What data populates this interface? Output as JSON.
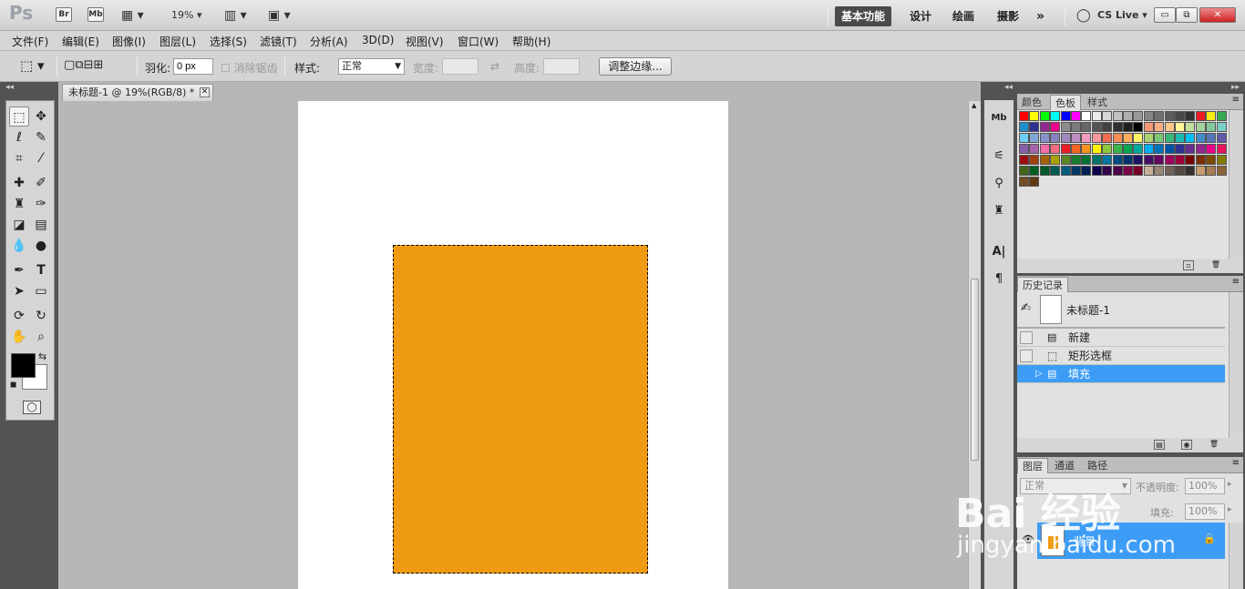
{
  "app": {
    "logo": "Ps",
    "bridge_btn": "Br",
    "minibridge_btn": "Mb",
    "zoom": "19%",
    "workspaces": [
      "基本功能",
      "设计",
      "绘画",
      "摄影"
    ],
    "more": "»",
    "cslive": "CS Live",
    "win_controls": [
      "▭",
      "⧉",
      "✕"
    ]
  },
  "menubar": [
    "文件(F)",
    "编辑(E)",
    "图像(I)",
    "图层(L)",
    "选择(S)",
    "滤镜(T)",
    "分析(A)",
    "3D(D)",
    "视图(V)",
    "窗口(W)",
    "帮助(H)"
  ],
  "options": {
    "feather_label": "羽化:",
    "feather_value": "0 px",
    "antialias_label": "消除锯齿",
    "style_label": "样式:",
    "style_value": "正常",
    "width_label": "宽度:",
    "height_label": "高度:",
    "refine_edge": "调整边缘..."
  },
  "document": {
    "tab_title": "未标题-1 @ 19%(RGB/8) *",
    "close": "✕",
    "fill_color": "#ef9a13"
  },
  "panels": {
    "color_tabs": [
      "颜色",
      "色板",
      "样式"
    ],
    "history_tab": "历史记录",
    "history_snapshot": "未标题-1",
    "history_items": [
      "新建",
      "矩形选框",
      "填充"
    ],
    "layers_tabs": [
      "图层",
      "通道",
      "路径"
    ],
    "blend_mode": "正常",
    "opacity_label": "不透明度:",
    "opacity_value": "100%",
    "fill_label": "填充:",
    "fill_value": "100%",
    "layer_name": "背景"
  },
  "watermark": {
    "line1": "Bai 经验",
    "line2": "jingyan.baidu.com"
  },
  "swatch_colors": [
    "#ff0000",
    "#ffff00",
    "#00ff00",
    "#00ffff",
    "#0000ff",
    "#ff00ff",
    "#ffffff",
    "#ebebeb",
    "#d6d6d6",
    "#c2c2c2",
    "#adadad",
    "#999999",
    "#858585",
    "#707070",
    "#5c5c5c",
    "#474747",
    "#333333",
    "#ed1c24",
    "#f7ec13",
    "#36a852",
    "#1f8fce",
    "#2f3192",
    "#92278f",
    "#ec008c",
    "#8c8c8c",
    "#7a7a7a",
    "#666666",
    "#545454",
    "#424242",
    "#303030",
    "#1f1f1f",
    "#000000",
    "#f7977a",
    "#f9ad81",
    "#fdc68a",
    "#fff79a",
    "#c4df9b",
    "#a3d39c",
    "#82ca9d",
    "#7bcdc8",
    "#6ecff6",
    "#7ea7d8",
    "#8493ca",
    "#8882be",
    "#a187be",
    "#bc8dbf",
    "#f49ac2",
    "#f6989d",
    "#f26c4f",
    "#f68e56",
    "#fbaf5c",
    "#fff467",
    "#acd372",
    "#7cc576",
    "#3bb878",
    "#1abbb4",
    "#00bff3",
    "#438ccb",
    "#5574b9",
    "#605ca8",
    "#855fa8",
    "#a763a8",
    "#f06ea9",
    "#f26d7d",
    "#ed1c24",
    "#f26522",
    "#f7941d",
    "#fff200",
    "#8dc63f",
    "#39b54a",
    "#00a651",
    "#00a99d",
    "#00aeef",
    "#0072bc",
    "#0054a6",
    "#2e3192",
    "#662d91",
    "#92278f",
    "#ec008c",
    "#ed145b",
    "#9e0b0f",
    "#a0410d",
    "#a36209",
    "#aba000",
    "#598527",
    "#1a7b30",
    "#007236",
    "#00746b",
    "#0076a3",
    "#004b80",
    "#003471",
    "#1b1464",
    "#440e62",
    "#630460",
    "#9e005d",
    "#9e0039",
    "#790000",
    "#7b2e00",
    "#7d4900",
    "#827b00",
    "#406618",
    "#005e20",
    "#005826",
    "#005952",
    "#005b7f",
    "#003663",
    "#002157",
    "#0d004c",
    "#32004b",
    "#4b0049",
    "#7b0046",
    "#7a0026",
    "#c7b299",
    "#998675",
    "#736357",
    "#534741",
    "#37302d",
    "#c69c6d",
    "#a67c52",
    "#8c6239",
    "#754c24",
    "#603913"
  ]
}
